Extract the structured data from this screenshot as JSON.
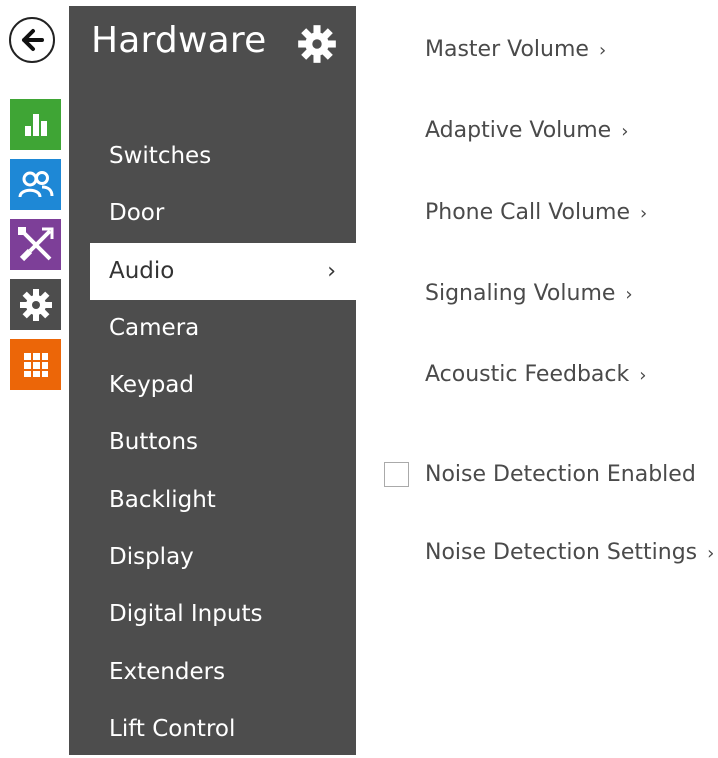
{
  "sidebar": {
    "title": "Hardware",
    "items": [
      {
        "label": "Switches"
      },
      {
        "label": "Door"
      },
      {
        "label": "Audio",
        "active": true
      },
      {
        "label": "Camera"
      },
      {
        "label": "Keypad"
      },
      {
        "label": "Buttons"
      },
      {
        "label": "Backlight"
      },
      {
        "label": "Display"
      },
      {
        "label": "Digital Inputs"
      },
      {
        "label": "Extenders"
      },
      {
        "label": "Lift Control"
      }
    ],
    "active_chevron": "›"
  },
  "rail": {
    "icons": [
      {
        "name": "back-arrow-icon"
      },
      {
        "name": "status-chart-icon",
        "color": "#3fa535"
      },
      {
        "name": "directory-users-icon",
        "color": "#1e88d6"
      },
      {
        "name": "hardware-tools-icon",
        "color": "#7d3f98"
      },
      {
        "name": "system-gear-icon",
        "color": "#4d4d4d"
      },
      {
        "name": "services-grid-icon",
        "color": "#ec6608"
      }
    ]
  },
  "content": {
    "links": [
      {
        "label": "Master Volume"
      },
      {
        "label": "Adaptive Volume"
      },
      {
        "label": "Phone Call Volume"
      },
      {
        "label": "Signaling Volume"
      },
      {
        "label": "Acoustic Feedback"
      }
    ],
    "noise_detection_enabled": {
      "label": "Noise Detection Enabled",
      "checked": false
    },
    "noise_detection_settings": {
      "label": "Noise Detection Settings"
    },
    "caret": "›"
  }
}
